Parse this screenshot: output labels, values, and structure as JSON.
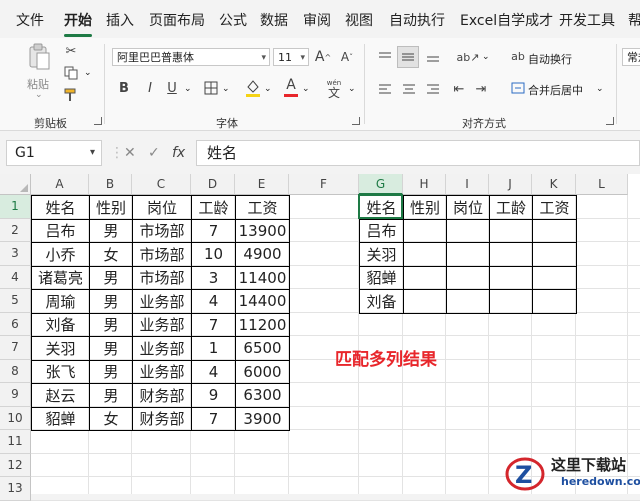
{
  "tabs": [
    {
      "label": "文件"
    },
    {
      "label": "开始"
    },
    {
      "label": "插入"
    },
    {
      "label": "页面布局"
    },
    {
      "label": "公式"
    },
    {
      "label": "数据"
    },
    {
      "label": "审阅"
    },
    {
      "label": "视图"
    },
    {
      "label": "自动执行"
    },
    {
      "label": "Excel自学成才"
    },
    {
      "label": "开发工具"
    },
    {
      "label": "帮"
    }
  ],
  "active_tab": "开始",
  "ribbon": {
    "paste_label": "粘贴",
    "clipboard_label": "剪贴板",
    "font_name": "阿里巴巴普惠体",
    "font_size": "11",
    "font_group_label": "字体",
    "bold": "B",
    "italic": "I",
    "underline": "U",
    "wen_label": "wén",
    "wen_char": "文",
    "wrap_label": "自动换行",
    "merge_label": "合并后居中",
    "align_label": "对齐方式",
    "number_format": "常规",
    "font_color": "#e8262b",
    "fill_color": "#f5d315"
  },
  "formula_bar": {
    "name_box": "G1",
    "fx": "fx",
    "content": "姓名"
  },
  "columns": [
    "A",
    "B",
    "C",
    "D",
    "E",
    "F",
    "G",
    "H",
    "I",
    "J",
    "K",
    "L"
  ],
  "rows": [
    "1",
    "2",
    "3",
    "4",
    "5",
    "6",
    "7",
    "8",
    "9",
    "10",
    "11",
    "12",
    "13"
  ],
  "selected": {
    "column": "G",
    "row": "1"
  },
  "source_table": {
    "headers": [
      "姓名",
      "性别",
      "岗位",
      "工龄",
      "工资"
    ],
    "rows": [
      [
        "吕布",
        "男",
        "市场部",
        "7",
        "13900"
      ],
      [
        "小乔",
        "女",
        "市场部",
        "10",
        "4900"
      ],
      [
        "诸葛亮",
        "男",
        "市场部",
        "3",
        "11400"
      ],
      [
        "周瑜",
        "男",
        "业务部",
        "4",
        "14400"
      ],
      [
        "刘备",
        "男",
        "业务部",
        "7",
        "11200"
      ],
      [
        "关羽",
        "男",
        "业务部",
        "1",
        "6500"
      ],
      [
        "张飞",
        "男",
        "业务部",
        "4",
        "6000"
      ],
      [
        "赵云",
        "男",
        "财务部",
        "9",
        "6300"
      ],
      [
        "貂蝉",
        "女",
        "财务部",
        "7",
        "3900"
      ]
    ]
  },
  "lookup_table": {
    "headers": [
      "姓名",
      "性别",
      "岗位",
      "工龄",
      "工资"
    ],
    "rows": [
      [
        "吕布",
        "",
        "",
        "",
        ""
      ],
      [
        "关羽",
        "",
        "",
        "",
        ""
      ],
      [
        "貂蝉",
        "",
        "",
        "",
        ""
      ],
      [
        "刘备",
        "",
        "",
        "",
        ""
      ]
    ]
  },
  "annotation": "匹配多列结果",
  "watermark": {
    "title": "这里下载站",
    "url": "heredown.com"
  },
  "colors": {
    "accent": "#1e7a45",
    "annotation": "#e8262b"
  }
}
